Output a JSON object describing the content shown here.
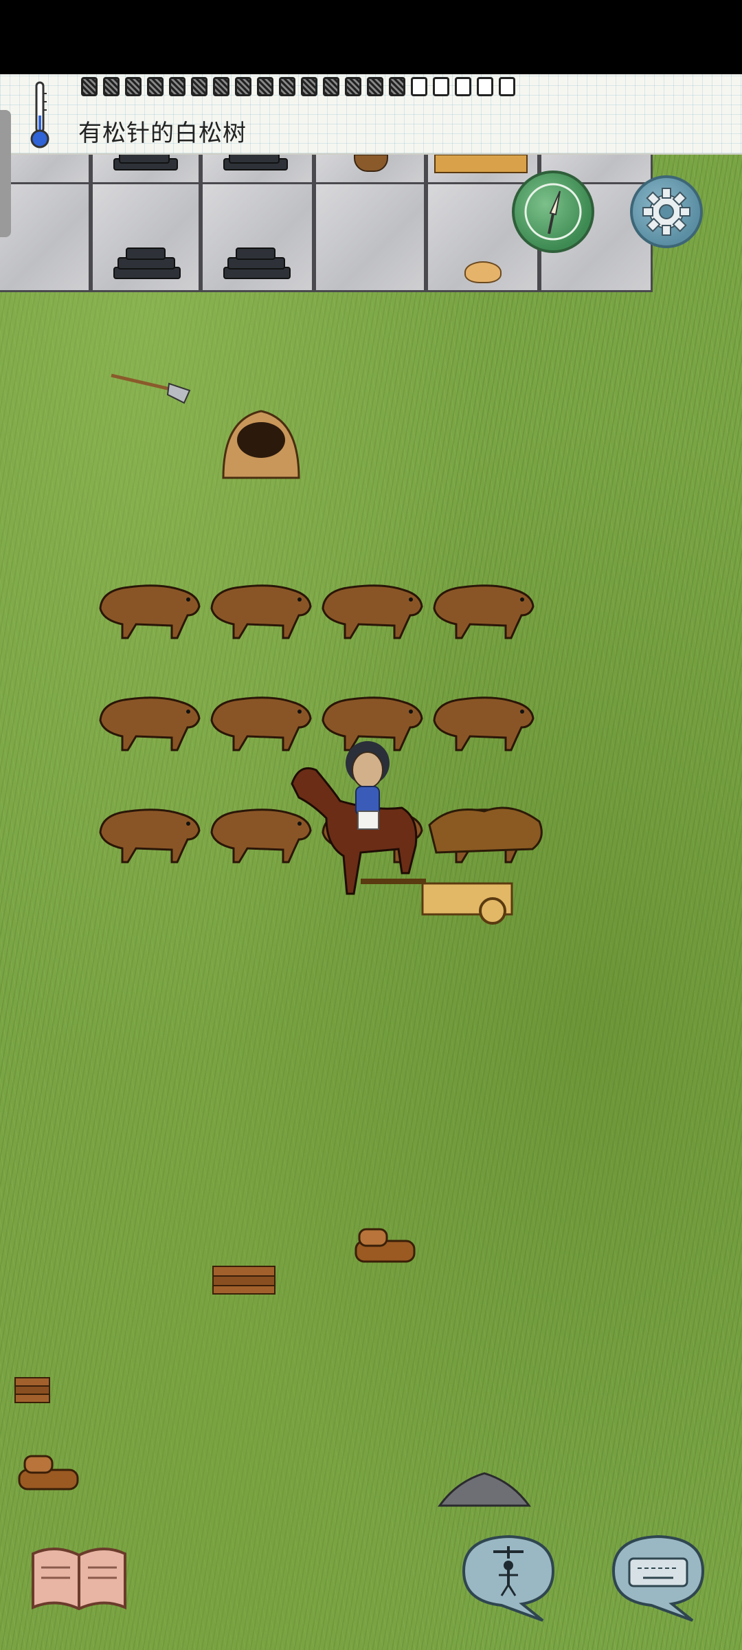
{
  "hud": {
    "biome_label": "有松针的白松树",
    "food_pips_total": 20,
    "food_pips_filled": 15,
    "temperature_icon": "thermometer-icon"
  },
  "buttons": {
    "compass_icon": "compass-icon",
    "settings_icon": "gear-icon",
    "recipe_book_icon": "book-icon",
    "emote_icon": "puppet-icon",
    "keyboard_icon": "keyboard-icon"
  },
  "world": {
    "boars_rows": 3,
    "boars_per_row": 4,
    "objects": [
      "shovel",
      "clay-kiln",
      "firewood",
      "firewood",
      "firewood",
      "firewood",
      "stone-pile",
      "horse-cart",
      "player"
    ]
  },
  "colors": {
    "grass": "#7aa545",
    "status_bar": "#000000",
    "compass_green": "#3d8a52",
    "settings_blue": "#5b8ea3"
  }
}
